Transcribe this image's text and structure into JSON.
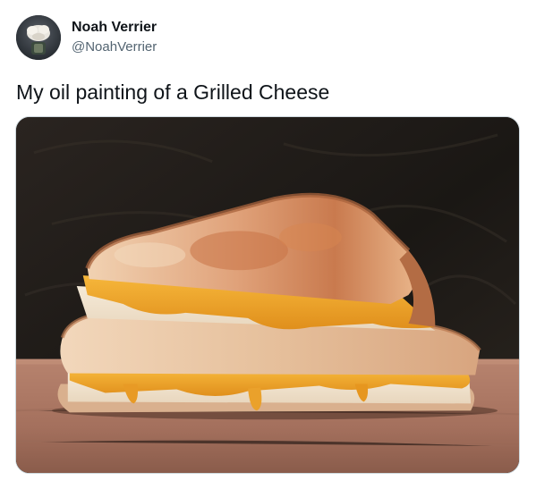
{
  "tweet": {
    "author_name": "Noah Verrier",
    "author_handle": "@NoahVerrier",
    "text": "My oil painting of a Grilled Cheese",
    "avatar_icon": "profile-avatar",
    "media_description_icon": "grilled-cheese-painting"
  },
  "colors": {
    "name_text": "#0f1419",
    "handle_text": "#536471",
    "media_border": "#cfd9de",
    "background": "#ffffff"
  }
}
